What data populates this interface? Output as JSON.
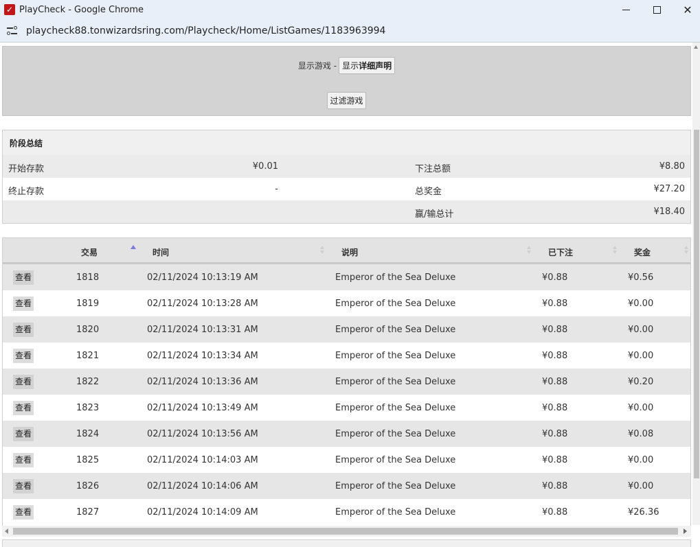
{
  "window": {
    "title": "PlayCheck - Google Chrome",
    "url": "playcheck88.tonwizardsring.com/Playcheck/Home/ListGames/1183963994"
  },
  "filter": {
    "show_games_label": "显示游戏 -",
    "detail_button_prefix": "显示",
    "detail_button_bold": "详细声明",
    "filter_button": "过滤游戏"
  },
  "summary": {
    "title": "阶段总结",
    "rows": [
      {
        "left_label": "开始存款",
        "left_value": "¥0.01",
        "right_label": "下注总额",
        "right_value": "¥8.80"
      },
      {
        "left_label": "终止存款",
        "left_value": "-",
        "right_label": "总奖金",
        "right_value": "¥27.20"
      },
      {
        "left_label": "",
        "left_value": "",
        "right_label": "赢/输总计",
        "right_value": "¥18.40"
      }
    ]
  },
  "games": {
    "columns": {
      "transaction": "交易",
      "time": "时间",
      "description": "说明",
      "bet": "已下注",
      "win": "奖金"
    },
    "view_label": "查看",
    "rows": [
      {
        "tx": "1818",
        "time": "02/11/2024 10:13:19 AM",
        "desc": "Emperor of the Sea Deluxe",
        "bet": "¥0.88",
        "win": "¥0.56"
      },
      {
        "tx": "1819",
        "time": "02/11/2024 10:13:28 AM",
        "desc": "Emperor of the Sea Deluxe",
        "bet": "¥0.88",
        "win": "¥0.00"
      },
      {
        "tx": "1820",
        "time": "02/11/2024 10:13:31 AM",
        "desc": "Emperor of the Sea Deluxe",
        "bet": "¥0.88",
        "win": "¥0.00"
      },
      {
        "tx": "1821",
        "time": "02/11/2024 10:13:34 AM",
        "desc": "Emperor of the Sea Deluxe",
        "bet": "¥0.88",
        "win": "¥0.00"
      },
      {
        "tx": "1822",
        "time": "02/11/2024 10:13:36 AM",
        "desc": "Emperor of the Sea Deluxe",
        "bet": "¥0.88",
        "win": "¥0.20"
      },
      {
        "tx": "1823",
        "time": "02/11/2024 10:13:49 AM",
        "desc": "Emperor of the Sea Deluxe",
        "bet": "¥0.88",
        "win": "¥0.00"
      },
      {
        "tx": "1824",
        "time": "02/11/2024 10:13:56 AM",
        "desc": "Emperor of the Sea Deluxe",
        "bet": "¥0.88",
        "win": "¥0.08"
      },
      {
        "tx": "1825",
        "time": "02/11/2024 10:14:03 AM",
        "desc": "Emperor of the Sea Deluxe",
        "bet": "¥0.88",
        "win": "¥0.00"
      },
      {
        "tx": "1826",
        "time": "02/11/2024 10:14:06 AM",
        "desc": "Emperor of the Sea Deluxe",
        "bet": "¥0.88",
        "win": "¥0.00"
      },
      {
        "tx": "1827",
        "time": "02/11/2024 10:14:09 AM",
        "desc": "Emperor of the Sea Deluxe",
        "bet": "¥0.88",
        "win": "¥26.36"
      }
    ]
  },
  "icons": {
    "app": "playcheck-logo-icon",
    "minimize": "minimize-icon",
    "maximize": "maximize-icon",
    "close": "close-icon",
    "site_info": "site-info-icon"
  }
}
